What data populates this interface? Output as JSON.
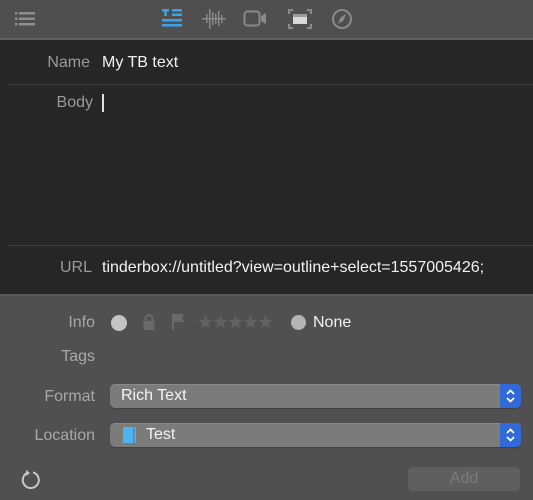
{
  "toolbar": {
    "icons": [
      {
        "name": "list-icon",
        "active": false
      },
      {
        "name": "text-format-icon",
        "active": true
      },
      {
        "name": "audio-waveform-icon",
        "active": false
      },
      {
        "name": "video-camera-icon",
        "active": false
      },
      {
        "name": "screenshot-icon",
        "active": false
      },
      {
        "name": "compass-icon",
        "active": false
      }
    ],
    "accent_color": "#3aa4e8"
  },
  "form": {
    "name_label": "Name",
    "name_value": "My TB text",
    "body_label": "Body",
    "body_value": "",
    "url_label": "URL",
    "url_value": "tinderbox://untitled?view=outline+select=1557005426;"
  },
  "details": {
    "info_label": "Info",
    "rating_stars": 0,
    "rating_max": 5,
    "label_value": "None",
    "tags_label": "Tags",
    "format_label": "Format",
    "format_value": "Rich Text",
    "location_label": "Location",
    "location_value": "Test",
    "add_button": "Add"
  }
}
